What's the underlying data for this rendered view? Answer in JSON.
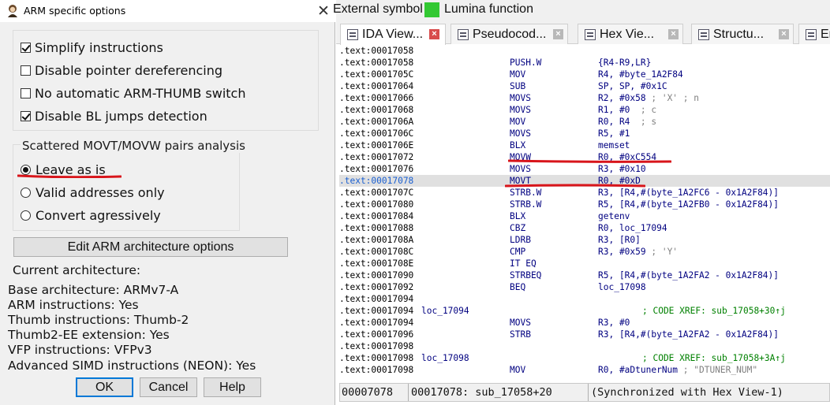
{
  "dialog": {
    "title": "ARM specific options",
    "close_glyph": "✕",
    "options": [
      {
        "label": "Simplify instructions",
        "checked": true
      },
      {
        "label": "Disable pointer dereferencing",
        "checked": false
      },
      {
        "label": "No automatic ARM-THUMB switch",
        "checked": false
      },
      {
        "label": "Disable BL jumps detection",
        "checked": true
      }
    ],
    "movt_group": {
      "title": "Scattered MOVT/MOVW pairs analysis",
      "choices": [
        {
          "label": "Leave as is",
          "selected": true
        },
        {
          "label": "Valid addresses only",
          "selected": false
        },
        {
          "label": "Convert agressively",
          "selected": false
        }
      ]
    },
    "edit_arch_label": "Edit ARM architecture options",
    "current_arch_label": "Current architecture:",
    "arch_info": [
      "Base architecture: ARMv7-A",
      "ARM instructions: Yes",
      "Thumb instructions: Thumb-2",
      "Thumb2-EE extension: Yes",
      "VFP instructions: VFPv3",
      "Advanced SIMD instructions (NEON): Yes"
    ],
    "buttons": {
      "ok": "OK",
      "cancel": "Cancel",
      "help": "Help"
    }
  },
  "ida": {
    "legend": {
      "external_symbol": "External symbol",
      "lumina_function": "Lumina function",
      "lumina_color": "#32c832"
    },
    "tabs": [
      {
        "label": "IDA View...",
        "active": true
      },
      {
        "label": "Pseudocod...",
        "active": false
      },
      {
        "label": "Hex Vie...",
        "active": false
      },
      {
        "label": "Structu...",
        "active": false
      },
      {
        "label": "En",
        "active": false
      }
    ],
    "listing": [
      {
        "addr": ".text:00017058",
        "label": "",
        "mnemonic": "",
        "operands": "",
        "comment": "",
        "xref": ""
      },
      {
        "addr": ".text:00017058",
        "label": "",
        "mnemonic": "PUSH.W",
        "operands": "{R4-R9,LR}",
        "comment": "",
        "xref": ""
      },
      {
        "addr": ".text:0001705C",
        "label": "",
        "mnemonic": "MOV",
        "operands": "R4, #byte_1A2F84",
        "comment": "",
        "xref": ""
      },
      {
        "addr": ".text:00017064",
        "label": "",
        "mnemonic": "SUB",
        "operands": "SP, SP, #0x1C",
        "comment": "",
        "xref": ""
      },
      {
        "addr": ".text:00017066",
        "label": "",
        "mnemonic": "MOVS",
        "operands": "R2, #0x58 ",
        "comment": "; 'X' ; n",
        "xref": ""
      },
      {
        "addr": ".text:00017068",
        "label": "",
        "mnemonic": "MOVS",
        "operands": "R1, #0  ",
        "comment": "; c",
        "xref": ""
      },
      {
        "addr": ".text:0001706A",
        "label": "",
        "mnemonic": "MOV",
        "operands": "R0, R4  ",
        "comment": "; s",
        "xref": ""
      },
      {
        "addr": ".text:0001706C",
        "label": "",
        "mnemonic": "MOVS",
        "operands": "R5, #1",
        "comment": "",
        "xref": ""
      },
      {
        "addr": ".text:0001706E",
        "label": "",
        "mnemonic": "BLX",
        "operands": "memset",
        "comment": "",
        "xref": ""
      },
      {
        "addr": ".text:00017072",
        "label": "",
        "mnemonic": "MOVW",
        "operands": "R0, #0xC554",
        "comment": "",
        "xref": ""
      },
      {
        "addr": ".text:00017076",
        "label": "",
        "mnemonic": "MOVS",
        "operands": "R3, #0x10",
        "comment": "",
        "xref": ""
      },
      {
        "addr": ".text:00017078",
        "label": "",
        "mnemonic": "MOVT",
        "operands": "R0, #0xD",
        "comment": "",
        "xref": "",
        "highlight": true
      },
      {
        "addr": ".text:0001707C",
        "label": "",
        "mnemonic": "STRB.W",
        "operands": "R3, [R4,#(byte_1A2FC6 - 0x1A2F84)]",
        "comment": "",
        "xref": ""
      },
      {
        "addr": ".text:00017080",
        "label": "",
        "mnemonic": "STRB.W",
        "operands": "R5, [R4,#(byte_1A2FB0 - 0x1A2F84)]",
        "comment": "",
        "xref": ""
      },
      {
        "addr": ".text:00017084",
        "label": "",
        "mnemonic": "BLX",
        "operands": "getenv",
        "comment": "",
        "xref": ""
      },
      {
        "addr": ".text:00017088",
        "label": "",
        "mnemonic": "CBZ",
        "operands": "R0, loc_17094",
        "comment": "",
        "xref": ""
      },
      {
        "addr": ".text:0001708A",
        "label": "",
        "mnemonic": "LDRB",
        "operands": "R3, [R0]",
        "comment": "",
        "xref": ""
      },
      {
        "addr": ".text:0001708C",
        "label": "",
        "mnemonic": "CMP",
        "operands": "R3, #0x59 ",
        "comment": "; 'Y'",
        "xref": ""
      },
      {
        "addr": ".text:0001708E",
        "label": "",
        "mnemonic": "IT EQ",
        "operands": "",
        "comment": "",
        "xref": ""
      },
      {
        "addr": ".text:00017090",
        "label": "",
        "mnemonic": "STRBEQ",
        "operands": "R5, [R4,#(byte_1A2FA2 - 0x1A2F84)]",
        "comment": "",
        "xref": ""
      },
      {
        "addr": ".text:00017092",
        "label": "",
        "mnemonic": "BEQ",
        "operands": "loc_17098",
        "comment": "",
        "xref": ""
      },
      {
        "addr": ".text:00017094",
        "label": "",
        "mnemonic": "",
        "operands": "",
        "comment": "",
        "xref": ""
      },
      {
        "addr": ".text:00017094",
        "label": "loc_17094",
        "mnemonic": "",
        "operands": "",
        "comment": "",
        "xref": "; CODE XREF: sub_17058+30↑j"
      },
      {
        "addr": ".text:00017094",
        "label": "",
        "mnemonic": "MOVS",
        "operands": "R3, #0",
        "comment": "",
        "xref": ""
      },
      {
        "addr": ".text:00017096",
        "label": "",
        "mnemonic": "STRB",
        "operands": "R3, [R4,#(byte_1A2FA2 - 0x1A2F84)]",
        "comment": "",
        "xref": ""
      },
      {
        "addr": ".text:00017098",
        "label": "",
        "mnemonic": "",
        "operands": "",
        "comment": "",
        "xref": ""
      },
      {
        "addr": ".text:00017098",
        "label": "loc_17098",
        "mnemonic": "",
        "operands": "",
        "comment": "",
        "xref": "; CODE XREF: sub_17058+3A↑j"
      },
      {
        "addr": ".text:00017098",
        "label": "",
        "mnemonic": "MOV",
        "operands": "R0, #aDtunerNum ",
        "comment": "; \"DTUNER_NUM\"",
        "xref": ""
      }
    ],
    "status": {
      "offset": "00007078",
      "address": "00017078: sub_17058+20",
      "sync": "(Synchronized with Hex View-1)"
    },
    "annotation_color": "#d8151b"
  }
}
